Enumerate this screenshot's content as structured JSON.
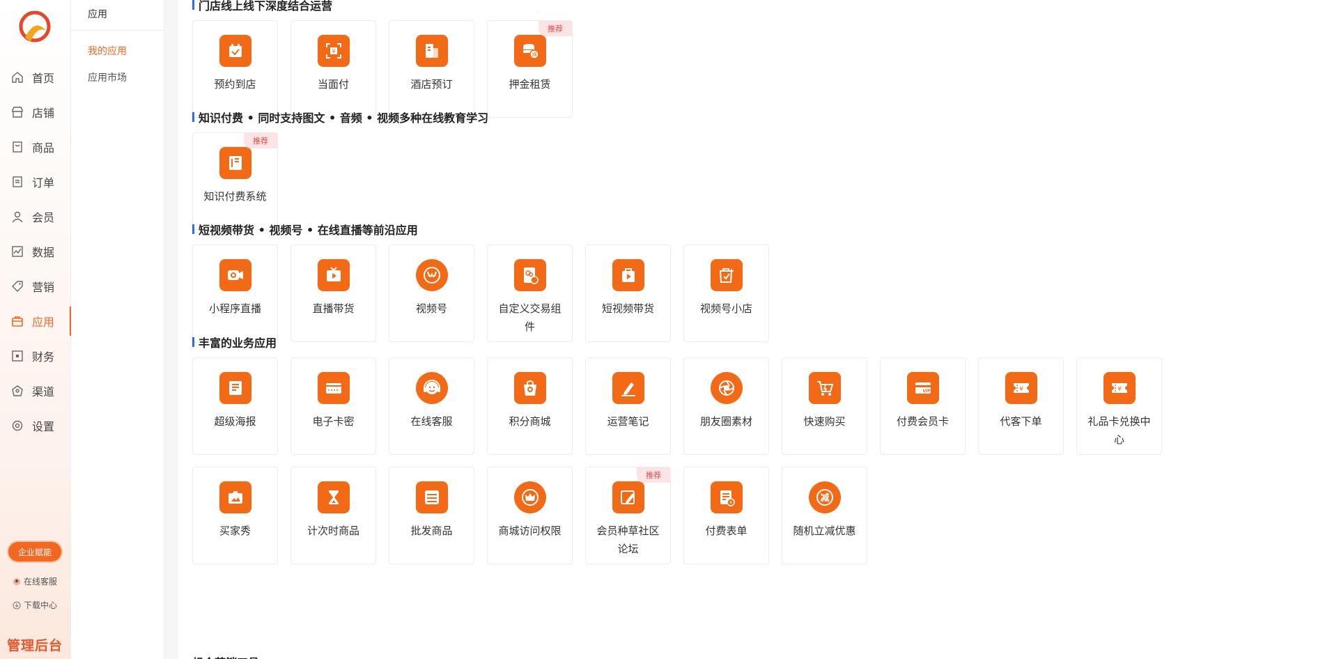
{
  "nav": [
    {
      "label": "首页",
      "icon": "home-icon"
    },
    {
      "label": "店铺",
      "icon": "store-icon"
    },
    {
      "label": "商品",
      "icon": "goods-icon"
    },
    {
      "label": "订单",
      "icon": "order-icon"
    },
    {
      "label": "会员",
      "icon": "member-icon"
    },
    {
      "label": "数据",
      "icon": "data-icon"
    },
    {
      "label": "营销",
      "icon": "tag-icon"
    },
    {
      "label": "应用",
      "icon": "app-icon",
      "active": true
    },
    {
      "label": "财务",
      "icon": "finance-icon"
    },
    {
      "label": "渠道",
      "icon": "channel-icon"
    },
    {
      "label": "设置",
      "icon": "gear-icon"
    }
  ],
  "sidebar_footer": {
    "enterprise_button": "企业赋能",
    "customer_service": "在线客服",
    "download_center": "下载中心",
    "brand": "管理后台"
  },
  "sub_sidebar": {
    "title": "应用",
    "items": [
      {
        "label": "我的应用",
        "active": true
      },
      {
        "label": "应用市场",
        "active": false
      }
    ]
  },
  "sections": [
    {
      "title": "门店线上线下深度结合运营",
      "cards": [
        {
          "label": "预约到店",
          "icon": "calendar-check-icon"
        },
        {
          "label": "当面付",
          "icon": "scan-pay-icon"
        },
        {
          "label": "酒店预订",
          "icon": "hotel-icon"
        },
        {
          "label": "押金租赁",
          "icon": "deposit-coins-icon",
          "badge": "推荐"
        }
      ]
    },
    {
      "title": "知识付费 • 同时支持图文 • 音频 • 视频多种在线教育学习",
      "cards": [
        {
          "label": "知识付费系统",
          "icon": "book-icon",
          "badge": "推荐"
        }
      ]
    },
    {
      "title": "短视频带货 • 视频号 • 在线直播等前沿应用",
      "cards": [
        {
          "label": "小程序直播",
          "icon": "live-camera-icon"
        },
        {
          "label": "直播带货",
          "icon": "tv-play-icon"
        },
        {
          "label": "视频号",
          "icon": "butterfly-icon"
        },
        {
          "label": "自定义交易组件",
          "icon": "wechat-component-icon"
        },
        {
          "label": "短视频带货",
          "icon": "video-bag-icon"
        },
        {
          "label": "视频号小店",
          "icon": "shop-bag-icon"
        }
      ]
    },
    {
      "title": "丰富的业务应用",
      "cards": [
        {
          "label": "超级海报",
          "icon": "poster-icon"
        },
        {
          "label": "电子卡密",
          "icon": "card-icon"
        },
        {
          "label": "在线客服",
          "icon": "headset-icon"
        },
        {
          "label": "积分商城",
          "icon": "points-bag-icon"
        },
        {
          "label": "运营笔记",
          "icon": "pen-note-icon"
        },
        {
          "label": "朋友圈素材",
          "icon": "aperture-icon"
        },
        {
          "label": "快速购买",
          "icon": "cart-icon"
        },
        {
          "label": "付费会员卡",
          "icon": "vip-card-icon"
        },
        {
          "label": "代客下单",
          "icon": "ticket-icon"
        },
        {
          "label": "礼品卡兑换中心",
          "icon": "gift-ticket-icon"
        },
        {
          "label": "买家秀",
          "icon": "photo-icon"
        },
        {
          "label": "计次时商品",
          "icon": "hourglass-icon"
        },
        {
          "label": "批发商品",
          "icon": "wholesale-icon"
        },
        {
          "label": "商城访问权限",
          "icon": "crown-icon"
        },
        {
          "label": "会员种草社区论坛",
          "icon": "edit-icon",
          "badge": "推荐"
        },
        {
          "label": "付费表单",
          "icon": "form-icon"
        },
        {
          "label": "随机立减优惠",
          "icon": "discount-icon"
        }
      ]
    }
  ],
  "next_section_partial": "组合营销工具",
  "colors": {
    "accent": "#f26722",
    "icon_bg": "#f26a15",
    "badge_bg": "#fde4e4",
    "badge_text": "#e24a4a",
    "title_bar": "#2e6bf0"
  }
}
